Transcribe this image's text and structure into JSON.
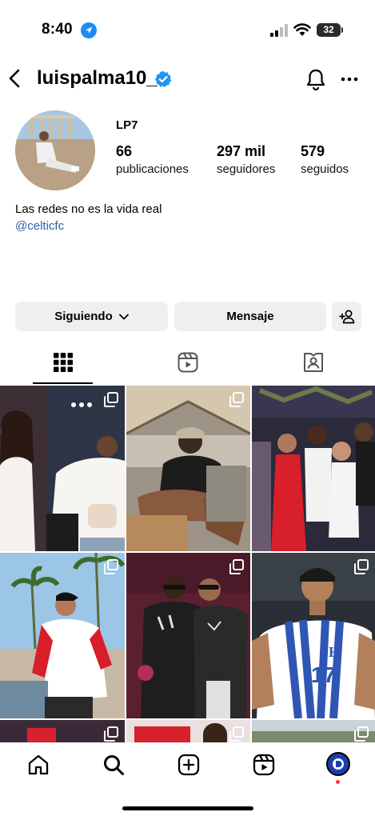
{
  "status_bar": {
    "time": "8:40",
    "battery": "32"
  },
  "header": {
    "username": "luispalma10_"
  },
  "profile": {
    "full_name": "LP7",
    "stats": [
      {
        "value": "66",
        "label": "publicaciones"
      },
      {
        "value": "297 mil",
        "label": "seguidores"
      },
      {
        "value": "579",
        "label": "seguidos"
      }
    ],
    "bio": "Las redes no es la vida real",
    "link": "@celticfc"
  },
  "actions": {
    "following_label": "Siguiendo",
    "message_label": "Mensaje"
  },
  "tabs": [
    "grid-icon",
    "reels-icon",
    "tagged-icon"
  ],
  "bottom_nav": [
    "home-icon",
    "search-icon",
    "create-icon",
    "reels-icon",
    "profile-avatar"
  ],
  "posts": [
    {
      "colors": [
        "#2c3445",
        "#d9d3cb",
        "#f4f1ee",
        "#1c1c1c"
      ],
      "multi": true
    },
    {
      "colors": [
        "#c8c0b0",
        "#7a6e5c",
        "#1c1c1c",
        "#b78a5b"
      ],
      "multi": true
    },
    {
      "colors": [
        "#2a2a3a",
        "#5a4a6a",
        "#d8202a",
        "#f2f2f2"
      ],
      "multi": false
    },
    {
      "colors": [
        "#9cc6e6",
        "#ffffff",
        "#c8b8a6",
        "#6e8a9e"
      ],
      "multi": true
    },
    {
      "colors": [
        "#5a2030",
        "#2a1820",
        "#1e1e1e",
        "#e0e0e0"
      ],
      "multi": true
    },
    {
      "colors": [
        "#2a2e36",
        "#ffffff",
        "#2f56b4",
        "#b3805c"
      ],
      "multi": true
    }
  ],
  "jersey_number": "17",
  "jersey_letter": "H",
  "accent": "#0095f6"
}
